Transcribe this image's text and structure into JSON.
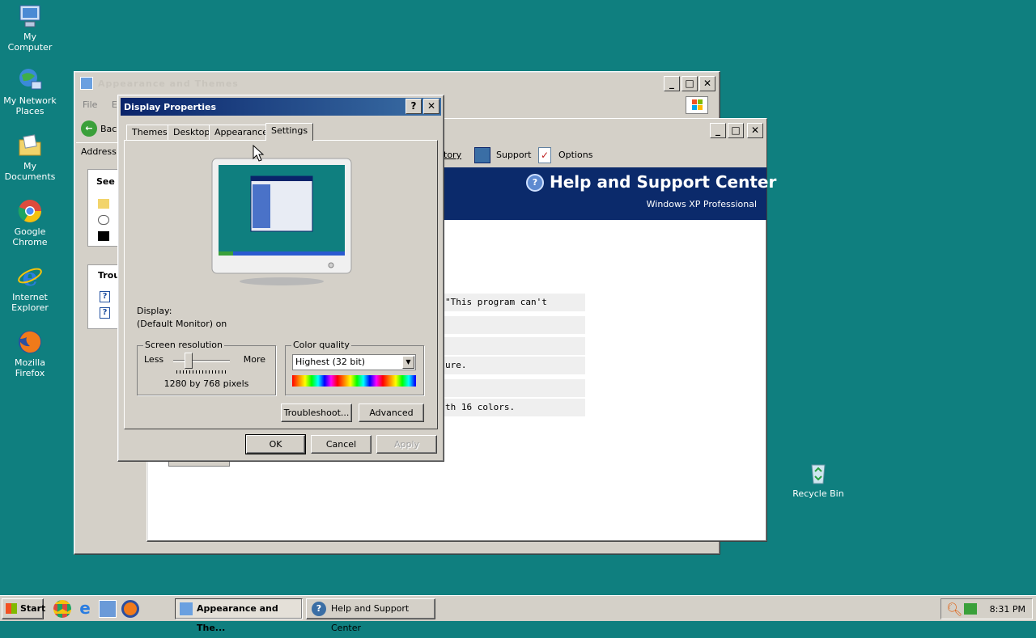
{
  "desktop": {
    "icons": [
      {
        "label": "My Computer"
      },
      {
        "label": "My Network Places"
      },
      {
        "label": "My Documents"
      },
      {
        "label": "Google Chrome"
      },
      {
        "label": "Internet Explorer"
      },
      {
        "label": "Mozilla Firefox"
      },
      {
        "label": "Recycle Bin"
      }
    ]
  },
  "appearance_window": {
    "title": "Appearance and Themes",
    "menu": [
      "File",
      "E"
    ],
    "back_label": "Bac",
    "address_label": "Address",
    "see_also_heading": "See a",
    "troubleshoot_heading": "Trou"
  },
  "help_window": {
    "toolbar": {
      "history_label": "tory",
      "support_label": "Support",
      "options_label": "Options"
    },
    "banner_title": "Help and Support Center",
    "banner_subtitle": "Windows XP Professional",
    "rows": [
      "\"This program can't continue.\"",
      "",
      "",
      "ure.",
      "",
      "th 16 colors."
    ]
  },
  "display_properties": {
    "title": "Display Properties",
    "tabs": [
      "Themes",
      "Desktop",
      "Appearance",
      "Settings"
    ],
    "active_tab": "Settings",
    "display_label": "Display:",
    "display_value": "(Default Monitor) on",
    "screen_resolution": {
      "label": "Screen resolution",
      "less": "Less",
      "more": "More",
      "value": "1280 by 768 pixels"
    },
    "color_quality": {
      "label": "Color quality",
      "selected": "Highest (32 bit)"
    },
    "buttons": {
      "troubleshoot": "Troubleshoot...",
      "advanced": "Advanced",
      "ok": "OK",
      "cancel": "Cancel",
      "apply": "Apply"
    }
  },
  "taskbar": {
    "start_label": "Start",
    "tasks": [
      {
        "label": "Appearance and The..."
      },
      {
        "label": "Help and Support Center"
      }
    ],
    "clock": "8:31 PM"
  },
  "colors": {
    "desktop": "#0f7f7f",
    "title_active": "#0a246a",
    "help_banner": "#0b2a6b"
  }
}
